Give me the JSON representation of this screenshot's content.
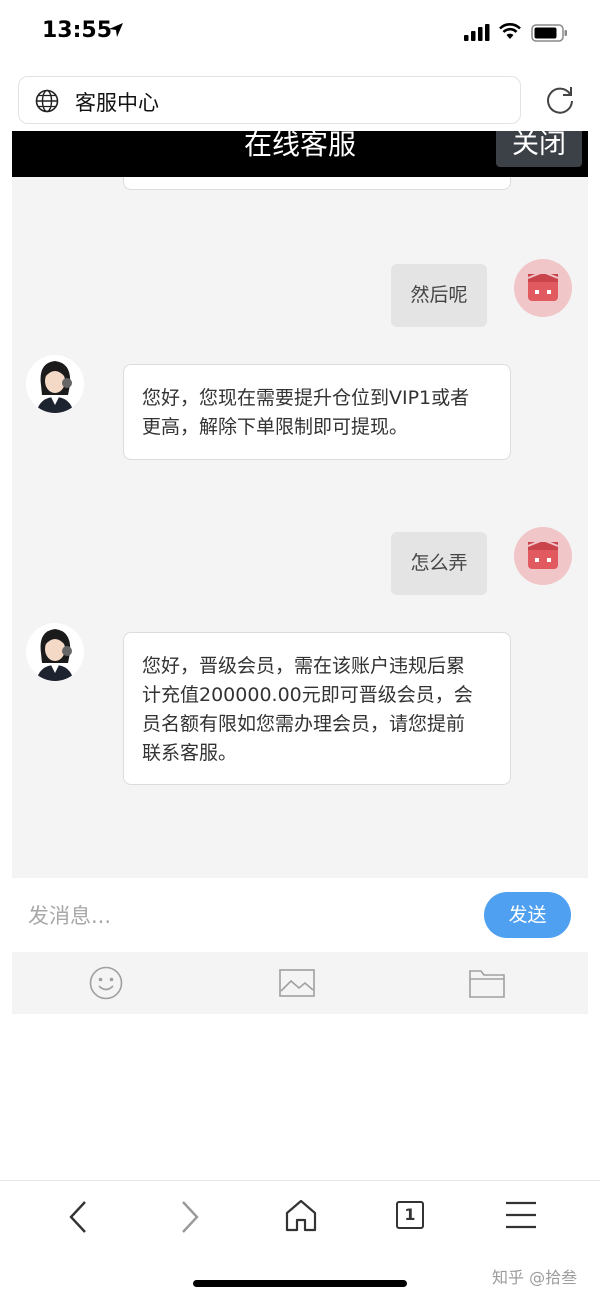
{
  "status_bar": {
    "time": "13:55"
  },
  "address_bar": {
    "title": "客服中心"
  },
  "chat_header": {
    "title": "在线客服",
    "close_label": "关闭"
  },
  "messages": [
    {
      "from": "user",
      "text": "然后呢"
    },
    {
      "from": "agent",
      "lines": [
        "您好，您现在需要提升仓位到VIP1或者",
        "更高，解除下单限制即可提现。"
      ]
    },
    {
      "from": "user",
      "text": "怎么弄"
    },
    {
      "from": "agent",
      "lines": [
        "您好，晋级会员，需在该账户违规后累",
        "计充值200000.00元即可晋级会员，会",
        "员名额有限如您需办理会员，请您提前",
        "联系客服。"
      ]
    }
  ],
  "composer": {
    "placeholder": "发消息...",
    "send_label": "发送"
  },
  "toolbar_icons": [
    "emoji-icon",
    "image-icon",
    "folder-icon"
  ],
  "bottom_nav": {
    "tab_count": "1"
  },
  "watermark": "知乎 @拾叁",
  "colors": {
    "send": "#4fa0f0",
    "header": "#000000",
    "user_avatar": "#e05a60"
  }
}
